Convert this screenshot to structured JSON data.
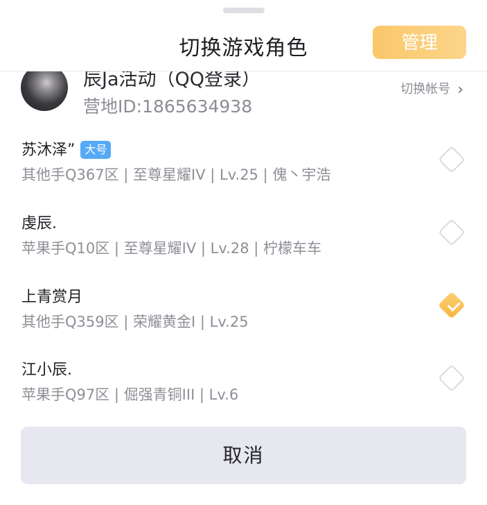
{
  "header": {
    "title": "切换游戏角色",
    "manage_label": "管理"
  },
  "account": {
    "name": "辰Ja活动（QQ登录）",
    "id_text": "营地ID:1865634938",
    "switch_label": "切换帐号",
    "chevron": "›"
  },
  "roles": [
    {
      "name": "苏沐泽”",
      "badge": "大号",
      "detail": "其他手Q367区 | 至尊星耀IV | Lv.25 | 傀丶宇浩",
      "selected": false
    },
    {
      "name": "虔辰.",
      "detail": "苹果手Q10区 | 至尊星耀IV | Lv.28 | 柠檬车车",
      "selected": false
    },
    {
      "name": "上青赏月",
      "detail": "其他手Q359区 | 荣耀黄金I | Lv.25",
      "selected": true
    },
    {
      "name": "江小辰.",
      "detail": "苹果手Q97区 | 倔强青铜III | Lv.6",
      "selected": false
    }
  ],
  "footer": {
    "cancel_label": "取消"
  },
  "colors": {
    "accent": "#F8B53F",
    "badge": "#56A9F5",
    "cancel_bg": "#E6E7EF"
  }
}
